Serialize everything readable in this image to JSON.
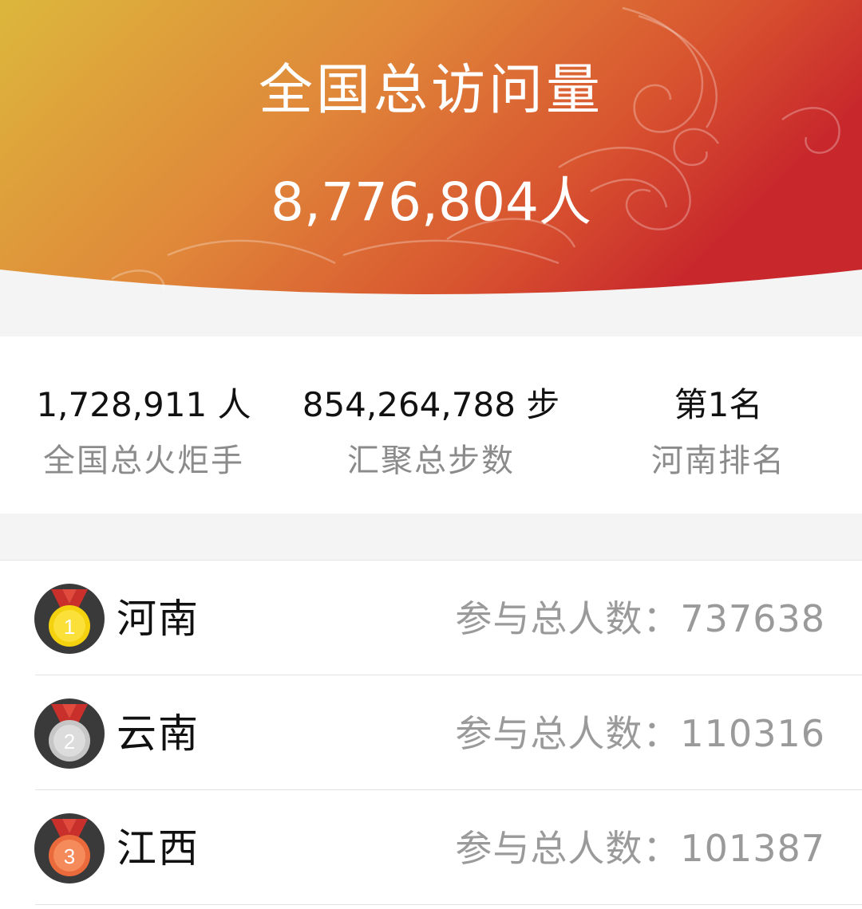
{
  "header": {
    "title": "全国总访问量",
    "total": "8,776,804人"
  },
  "stats": [
    {
      "value": "1,728,911 人",
      "label": "全国总火炬手"
    },
    {
      "value": "854,264,788 步",
      "label": "汇聚总步数"
    },
    {
      "value": "第1名",
      "label": "河南排名"
    }
  ],
  "ranking": [
    {
      "rank": "1",
      "province": "河南",
      "count_label": "参与总人数：",
      "count": "737638",
      "medal_icon": "gold-medal-icon"
    },
    {
      "rank": "2",
      "province": "云南",
      "count_label": "参与总人数：",
      "count": "110316",
      "medal_icon": "silver-medal-icon"
    },
    {
      "rank": "3",
      "province": "江西",
      "count_label": "参与总人数：",
      "count": "101387",
      "medal_icon": "bronze-medal-icon"
    }
  ],
  "colors": {
    "banner_gradient_start": "#dcb73c",
    "banner_gradient_mid": "#e0823a",
    "banner_gradient_end": "#c8282c",
    "gold": "#f5d20e",
    "silver": "#d3d3d3",
    "bronze": "#f07a4a",
    "ribbon": "#c9302c"
  }
}
